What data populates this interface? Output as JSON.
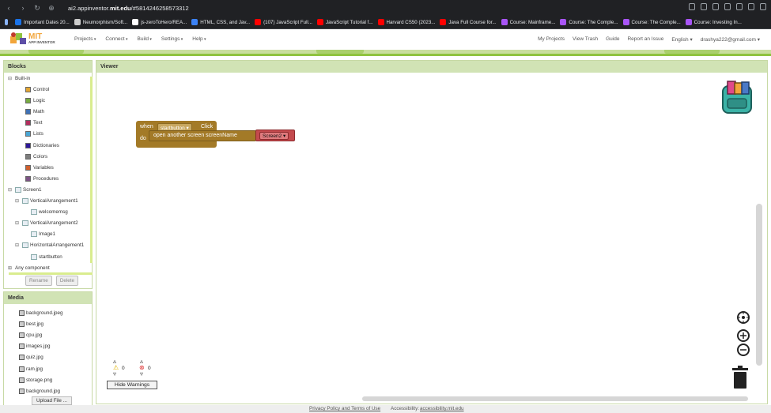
{
  "browser": {
    "url_prefix": "ai2.appinventor.",
    "url_domain": "mit.edu",
    "url_suffix": "/#5814246258573312",
    "bookmarks": [
      {
        "label": "Important Dates 20...",
        "color": "#1a73e8"
      },
      {
        "label": "Neumorphism/Soft...",
        "color": "#cccccc"
      },
      {
        "label": "js-zeroToHero/REA...",
        "color": "#ffffff"
      },
      {
        "label": "HTML, CSS, and Jav...",
        "color": "#3b82f6"
      },
      {
        "label": "(107) JavaScript Full...",
        "color": "#ff0000"
      },
      {
        "label": "JavaScript Tutorial f...",
        "color": "#ff0000"
      },
      {
        "label": "Harvard CS50 (2023...",
        "color": "#ff0000"
      },
      {
        "label": "Java Full Course for...",
        "color": "#ff0000"
      },
      {
        "label": "Course: Mainframe...",
        "color": "#a855f7"
      },
      {
        "label": "Course: The Comple...",
        "color": "#a855f7"
      },
      {
        "label": "Course: The Comple...",
        "color": "#a855f7"
      },
      {
        "label": "Course: Investing In...",
        "color": "#a855f7"
      }
    ]
  },
  "header": {
    "logo_top": "MIT",
    "logo_bottom": "APP INVENTOR",
    "menus": [
      "Projects",
      "Connect",
      "Build",
      "Settings",
      "Help"
    ],
    "right_links": [
      "My Projects",
      "View Trash",
      "Guide",
      "Report an Issue",
      "English ▾",
      "drashya222@gmail.com ▾"
    ]
  },
  "blocks_panel": {
    "title": "Blocks",
    "builtin_label": "Built-in",
    "builtin": [
      {
        "label": "Control",
        "color": "#e1a533"
      },
      {
        "label": "Logic",
        "color": "#77ab41"
      },
      {
        "label": "Math",
        "color": "#3f71b5"
      },
      {
        "label": "Text",
        "color": "#b32d5e"
      },
      {
        "label": "Lists",
        "color": "#49a6d4"
      },
      {
        "label": "Dictionaries",
        "color": "#2d1799"
      },
      {
        "label": "Colors",
        "color": "#7d7d7d"
      },
      {
        "label": "Variables",
        "color": "#d05f2d"
      },
      {
        "label": "Procedures",
        "color": "#7c5385"
      }
    ],
    "screen_label": "Screen1",
    "components": [
      {
        "label": "VerticalArrangement1",
        "level": 1
      },
      {
        "label": "welcomemsg",
        "level": 2
      },
      {
        "label": "VerticalArrangement2",
        "level": 1
      },
      {
        "label": "Image1",
        "level": 2
      },
      {
        "label": "HorizontalArrangement1",
        "level": 1
      },
      {
        "label": "startbutton",
        "level": 2
      }
    ],
    "any_component": "Any component",
    "rename_label": "Rename",
    "delete_label": "Delete"
  },
  "media_panel": {
    "title": "Media",
    "files": [
      "background.jpeg",
      "best.jpg",
      "cpu.jpg",
      "images.jpg",
      "quiz.jpg",
      "ram.jpg",
      "storage.png",
      "background.jpg"
    ],
    "upload_label": "Upload File ..."
  },
  "viewer": {
    "title": "Viewer",
    "event_when": "when",
    "event_component": "startbutton",
    "event_name": "Click",
    "event_do": "do",
    "call_label": "open another screen  screenName",
    "screen_value": "Screen2",
    "warnings_count": "0",
    "errors_count": "0",
    "hide_warnings_label": "Hide Warnings"
  },
  "footer": {
    "privacy": "Privacy Policy and Terms of Use",
    "accessibility_label": "Accessibility:",
    "accessibility_link": "accessibility.mit.edu"
  }
}
